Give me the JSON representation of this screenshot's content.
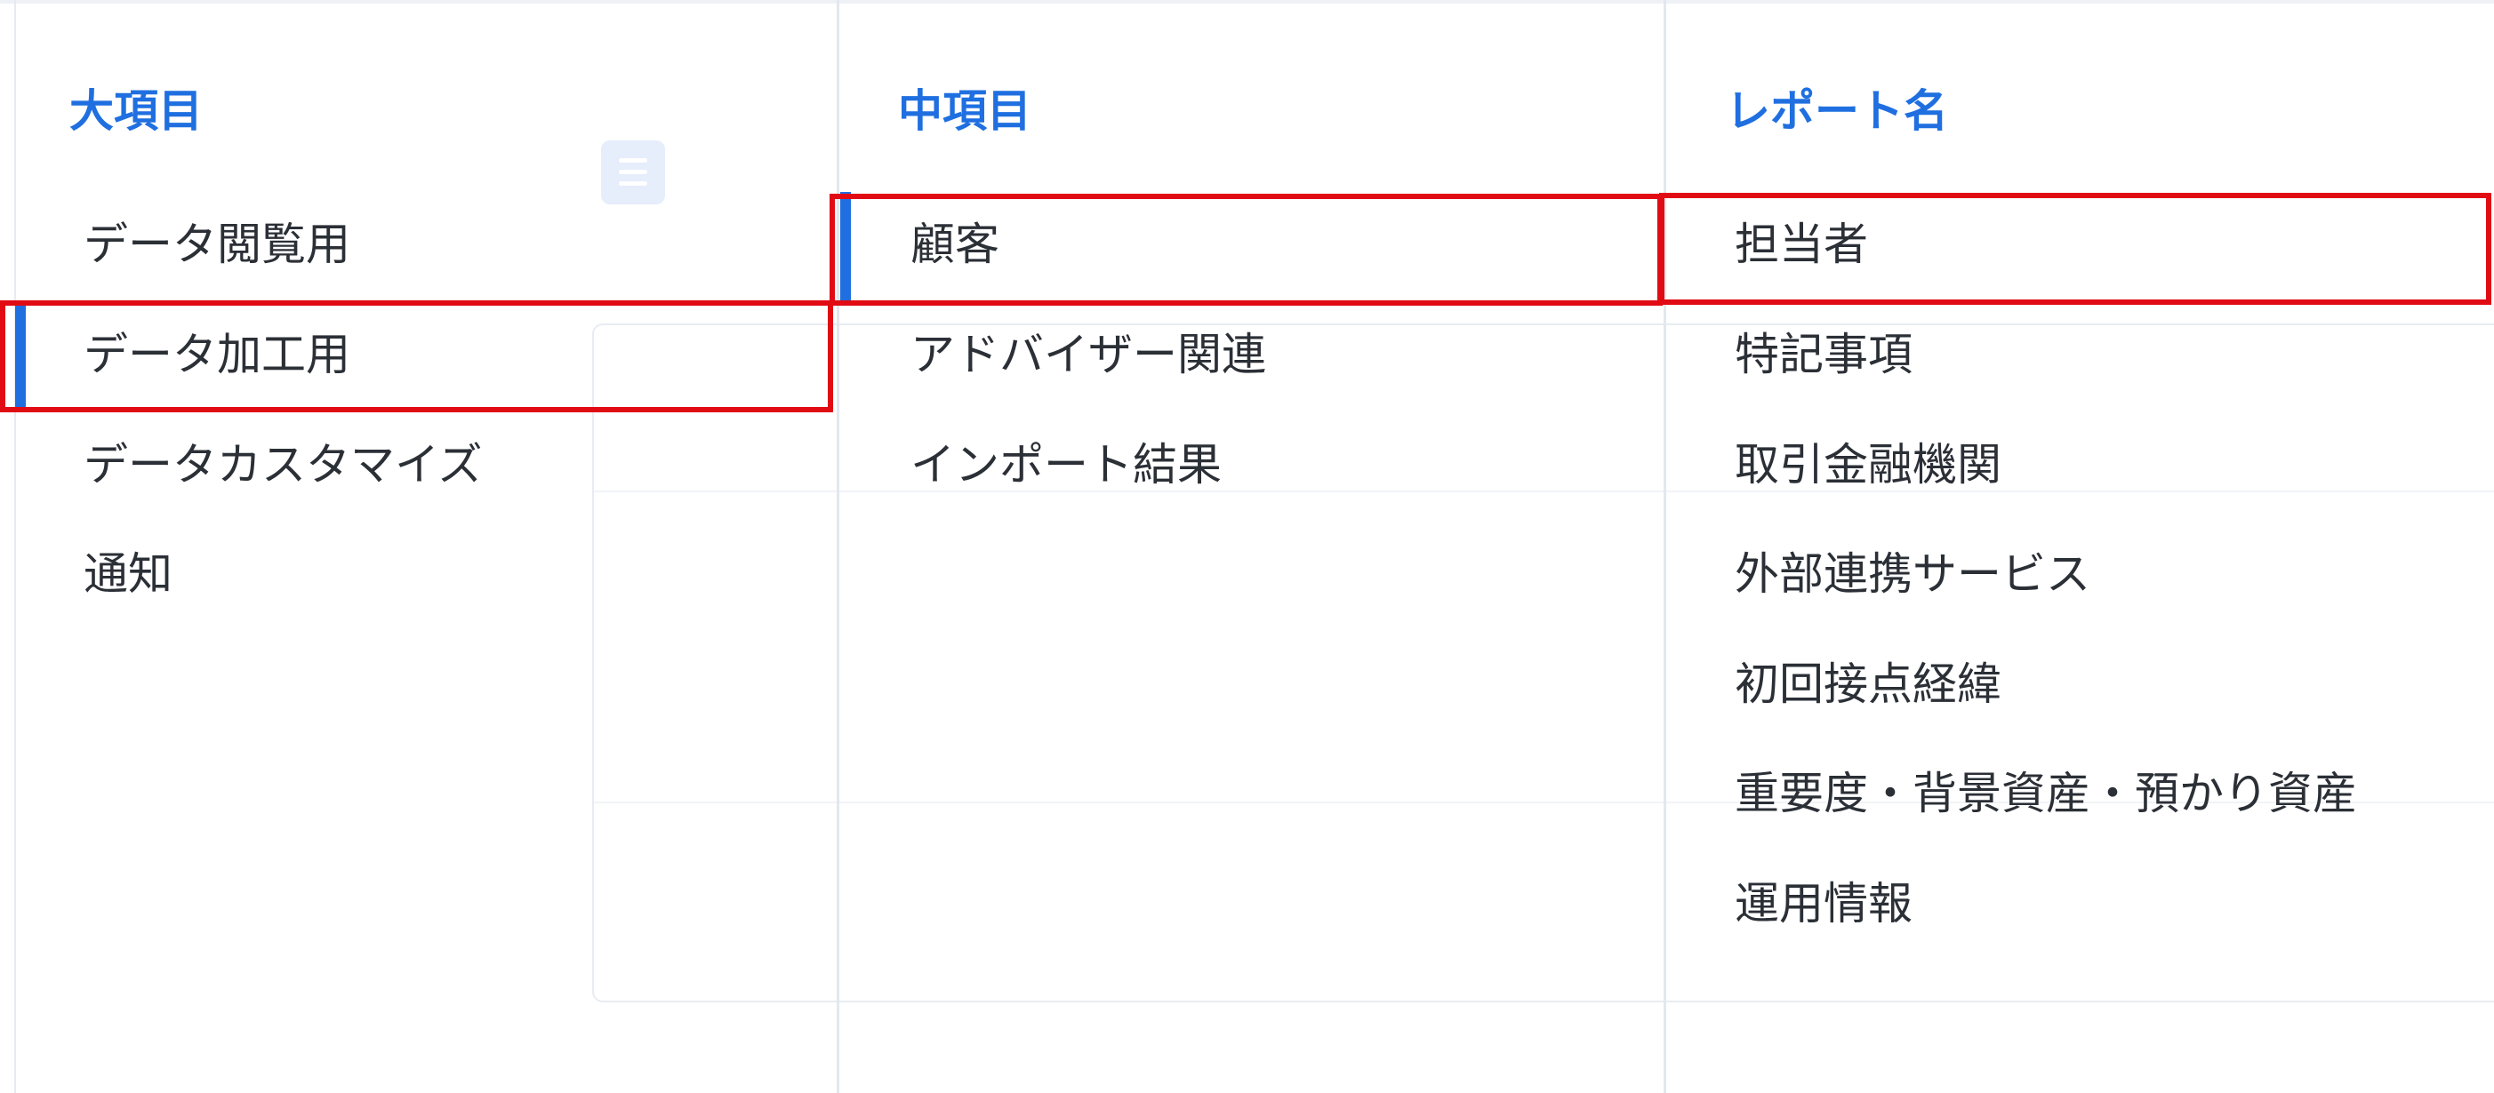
{
  "columns": [
    {
      "header": "大項目",
      "items": [
        {
          "label": "データ閲覧用"
        },
        {
          "label": "データ加工用"
        },
        {
          "label": "データカスタマイズ"
        },
        {
          "label": "通知"
        }
      ],
      "selected_index": 1
    },
    {
      "header": "中項目",
      "items": [
        {
          "label": "顧客"
        },
        {
          "label": "アドバイザー関連"
        },
        {
          "label": "インポート結果"
        }
      ],
      "selected_index": 0
    },
    {
      "header": "レポート名",
      "items": [
        {
          "label": "担当者"
        },
        {
          "label": "特記事項"
        },
        {
          "label": "取引金融機関"
        },
        {
          "label": "外部連携サービス"
        },
        {
          "label": "初回接点経緯"
        },
        {
          "label": "重要度・背景資産・預かり資産"
        },
        {
          "label": "運用情報"
        }
      ],
      "selected_index": 0
    }
  ],
  "colors": {
    "accent": "#1f6fe0",
    "highlight": "#e10b14",
    "text": "#2b2f36",
    "divider": "#e3e7ee"
  },
  "icons": {
    "background_document": "document-icon"
  }
}
